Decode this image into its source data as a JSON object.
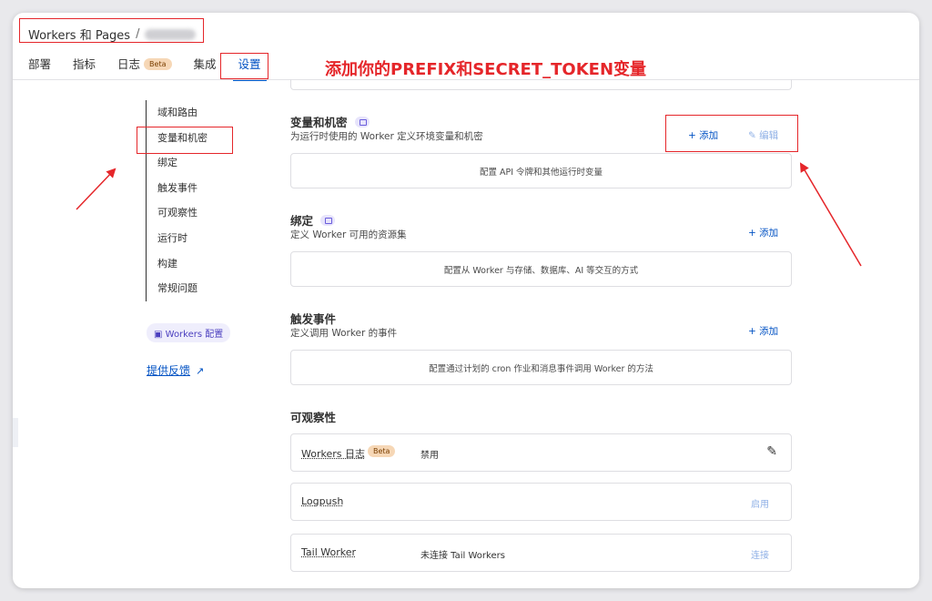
{
  "header": {
    "breadcrumb_root": "Workers 和 Pages",
    "breadcrumb_sep": "/"
  },
  "tabs": [
    {
      "label": "部署"
    },
    {
      "label": "指标"
    },
    {
      "label": "日志",
      "badge": "Beta"
    },
    {
      "label": "集成"
    },
    {
      "label": "设置",
      "active": true
    }
  ],
  "annotation": {
    "title": "添加你的PREFIX和SECRET_TOKEN变量",
    "color": "#e5262a"
  },
  "sidebar": {
    "items": [
      {
        "label": "域和路由"
      },
      {
        "label": "变量和机密"
      },
      {
        "label": "绑定"
      },
      {
        "label": "触发事件"
      },
      {
        "label": "可观察性"
      },
      {
        "label": "运行时"
      },
      {
        "label": "构建"
      },
      {
        "label": "常规问题"
      }
    ],
    "workers_badge": "Workers 配置",
    "feedback": "提供反馈"
  },
  "sections": {
    "variables": {
      "title": "变量和机密",
      "subtitle": "为运行时使用的 Worker 定义环境变量和机密",
      "add": "+ 添加",
      "edit": "编辑",
      "empty": "配置 API 令牌和其他运行时变量"
    },
    "bindings": {
      "title": "绑定",
      "subtitle": "定义 Worker 可用的资源集",
      "add": "+ 添加",
      "empty": "配置从 Worker 与存储、数据库、AI 等交互的方式"
    },
    "triggers": {
      "title": "触发事件",
      "subtitle": "定义调用 Worker 的事件",
      "add": "+ 添加",
      "empty": "配置通过计划的 cron 作业和消息事件调用 Worker 的方法"
    },
    "observability": {
      "title": "可观察性",
      "rows": [
        {
          "label": "Workers 日志",
          "badge": "Beta",
          "value": "禁用"
        },
        {
          "label": "Logpush",
          "action": "启用"
        },
        {
          "label": "Tail Worker",
          "value": "未连接 Tail Workers",
          "action": "连接"
        }
      ]
    }
  },
  "colors": {
    "link": "#0051c3",
    "link_disabled": "#8fb0e6",
    "beta_bg": "#f6d7b6"
  }
}
